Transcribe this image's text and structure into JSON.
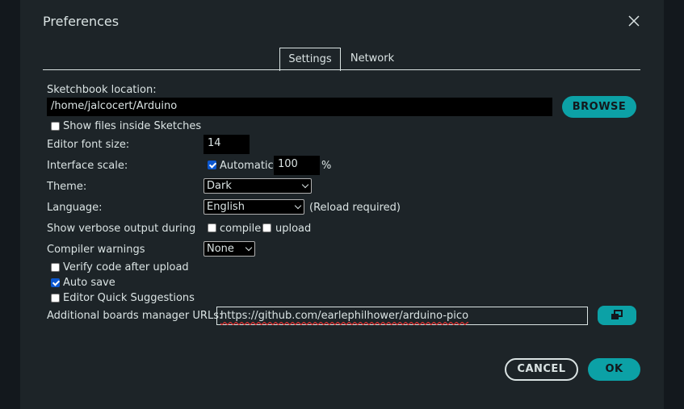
{
  "dialog": {
    "title": "Preferences"
  },
  "tabs": [
    {
      "label": "Settings",
      "active": true
    },
    {
      "label": "Network",
      "active": false
    }
  ],
  "settings": {
    "sketchbook_label": "Sketchbook location:",
    "sketchbook_value": "/home/jalcocert/Arduino",
    "browse_label": "BROWSE",
    "show_files_label": "Show files inside Sketches",
    "show_files_checked": false,
    "font_size_label": "Editor font size:",
    "font_size_value": "14",
    "interface_scale_label": "Interface scale:",
    "automatic_label": "Automatic",
    "automatic_checked": true,
    "scale_value": "100",
    "scale_unit": "%",
    "theme_label": "Theme:",
    "theme_value": "Dark",
    "language_label": "Language:",
    "language_value": "English",
    "reload_note": "(Reload required)",
    "verbose_label": "Show verbose output during",
    "compile_label": "compile",
    "compile_checked": false,
    "upload_label": "upload",
    "upload_checked": false,
    "warnings_label": "Compiler warnings",
    "warnings_value": "None",
    "verify_label": "Verify code after upload",
    "verify_checked": false,
    "autosave_label": "Auto save",
    "autosave_checked": true,
    "quick_suggestions_label": "Editor Quick Suggestions",
    "quick_suggestions_checked": false,
    "boards_url_label": "Additional boards manager URLs:",
    "boards_url_value": "https://github.com/earlephilhower/arduino-pico"
  },
  "footer": {
    "cancel_label": "CANCEL",
    "ok_label": "OK"
  },
  "colors": {
    "accent": "#0ca1a6",
    "background": "#1d2428",
    "text": "#dae3e3"
  },
  "icons": {
    "close": "close-icon",
    "open_window": "open-window-icon"
  }
}
